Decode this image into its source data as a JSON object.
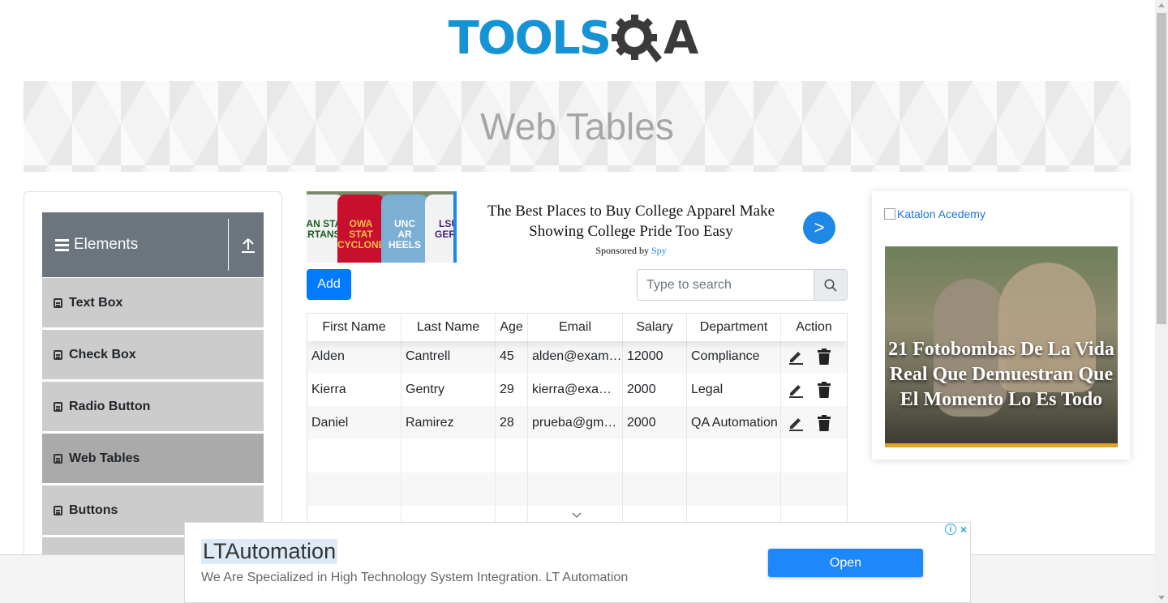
{
  "logo": {
    "text": "TOOLS",
    "q_icon": "gear-magnifier-icon",
    "a_text": "A"
  },
  "page": {
    "title": "Web Tables"
  },
  "sidebar": {
    "group_label": "Elements",
    "items": [
      {
        "label": "Text Box",
        "active": false
      },
      {
        "label": "Check Box",
        "active": false
      },
      {
        "label": "Radio Button",
        "active": false
      },
      {
        "label": "Web Tables",
        "active": true
      },
      {
        "label": "Buttons",
        "active": false
      }
    ]
  },
  "ad_top": {
    "title": "The Best Places to Buy College Apparel Make Showing College Pride Too Easy",
    "sponsored_prefix": "Sponsored by",
    "sponsor": "Spy",
    "arrow": ">",
    "shirts": [
      {
        "text": "BAN STA\nARTANS",
        "color": "#f2f2f2",
        "ink": "#1b5e20"
      },
      {
        "text": "OWA STAT\nCYCLONES",
        "color": "#c8102e",
        "ink": "#f1be48"
      },
      {
        "text": "UNC\nAR HEELS",
        "color": "#7bafd4",
        "ink": "#ffffff"
      },
      {
        "text": "LSU\nGERS",
        "color": "#f2f2f2",
        "ink": "#461d7c"
      }
    ]
  },
  "controls": {
    "add_label": "Add",
    "search_placeholder": "Type to search"
  },
  "table": {
    "columns": [
      "First Name",
      "Last Name",
      "Age",
      "Email",
      "Salary",
      "Department",
      "Action"
    ],
    "rows": [
      [
        "Alden",
        "Cantrell",
        "45",
        "alden@example.com",
        "12000",
        "Compliance"
      ],
      [
        "Kierra",
        "Gentry",
        "29",
        "kierra@example.com",
        "2000",
        "Legal"
      ],
      [
        "Daniel",
        "Ramirez",
        "28",
        "prueba@gmail.com",
        "2000",
        "QA Automation"
      ]
    ],
    "empty_rows": 3
  },
  "ad_right": {
    "link_text": "Katalon Acedemy",
    "headline": "21 Fotobombas De La Vida Real Que Demuestran Que El Momento Lo Es Todo"
  },
  "ad_bottom": {
    "title": "LTAutomation",
    "description": "We Are Specialized in High Technology System Integration. LT Automation",
    "button": "Open",
    "info": "i",
    "close": "×"
  },
  "colors": {
    "brand_blue": "#1593d4",
    "primary": "#007bff",
    "sidebar_header": "#6c757d",
    "menu_item": "#cccccc",
    "menu_active": "#aaaaaa"
  }
}
